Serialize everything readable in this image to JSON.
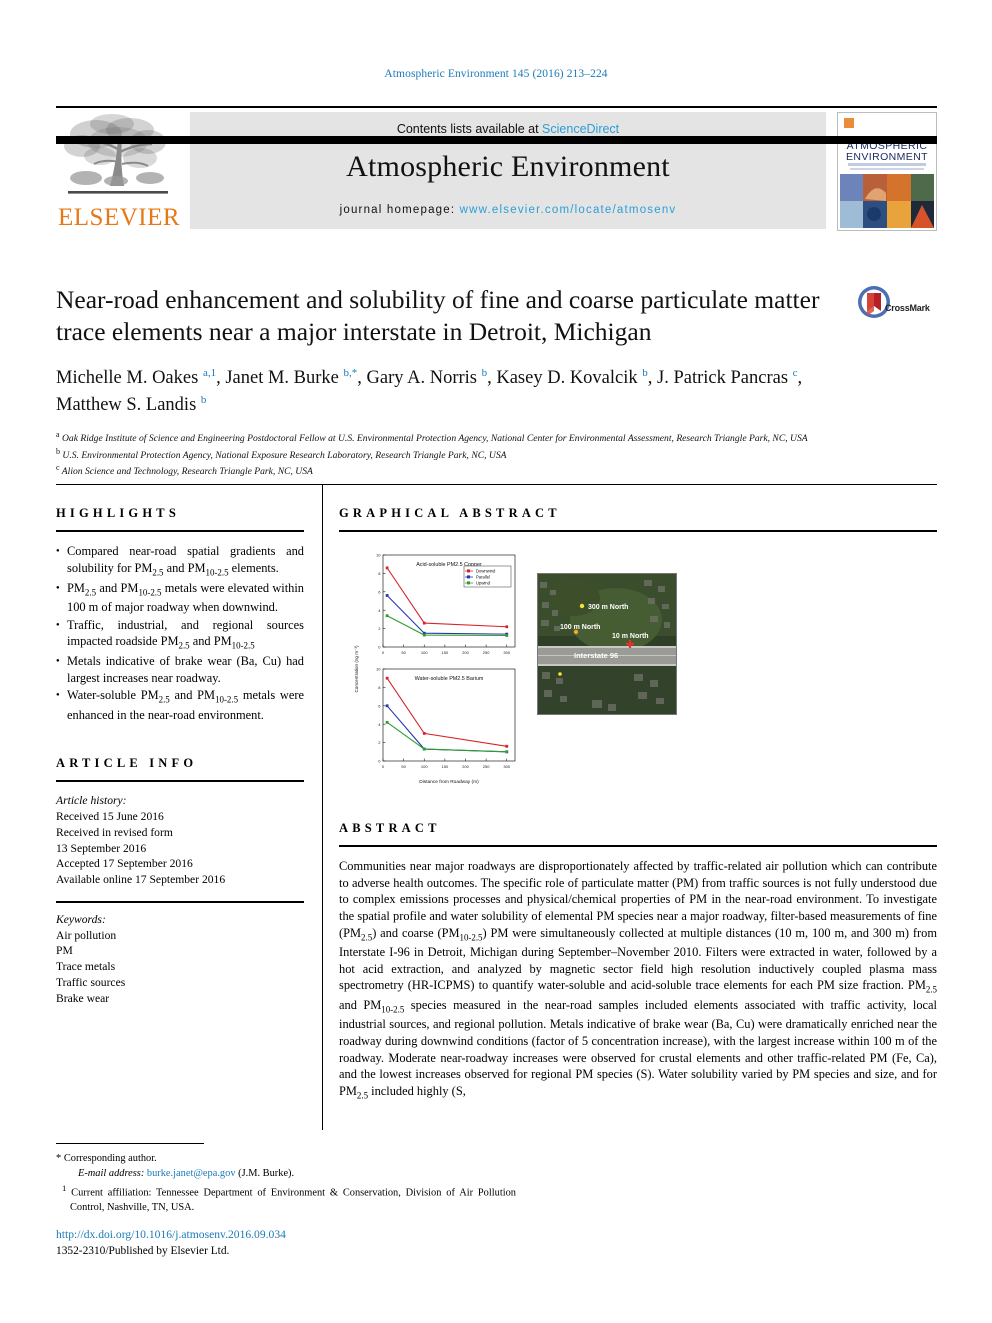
{
  "running_head": "Atmospheric Environment 145 (2016) 213–224",
  "masthead": {
    "contents_prefix": "Contents lists available at ",
    "sciencedirect": "ScienceDirect",
    "journal_title": "Atmospheric Environment",
    "homepage_prefix": "journal homepage: ",
    "homepage_url": "www.elsevier.com/locate/atmosenv",
    "publisher": "ELSEVIER",
    "cover_title_line1": "ATMOSPHERIC",
    "cover_title_line2": "ENVIRONMENT",
    "accent_blue": "#2b9fd6",
    "elsevier_orange": "#e77817"
  },
  "title": "Near-road enhancement and solubility of fine and coarse particulate matter trace elements near a major interstate in Detroit, Michigan",
  "crossmark_label": "CrossMark",
  "authors_html": "Michelle M. Oakes <sup>a,1</sup>, Janet M. Burke <sup>b,</sup><sup class=\"star\">*</sup>, Gary A. Norris <sup>b</sup>, Kasey D. Kovalcik <sup>b</sup>, J. Patrick Pancras <sup>c</sup>, Matthew S. Landis <sup>b</sup>",
  "affiliations": [
    {
      "marker": "a",
      "text": "Oak Ridge Institute of Science and Engineering Postdoctoral Fellow at U.S. Environmental Protection Agency, National Center for Environmental Assessment, Research Triangle Park, NC, USA"
    },
    {
      "marker": "b",
      "text": "U.S. Environmental Protection Agency, National Exposure Research Laboratory, Research Triangle Park, NC, USA"
    },
    {
      "marker": "c",
      "text": "Alion Science and Technology, Research Triangle Park, NC, USA"
    }
  ],
  "sections": {
    "highlights_heading": "HIGHLIGHTS",
    "graphical_abstract_heading": "GRAPHICAL ABSTRACT",
    "article_info_heading": "ARTICLE INFO",
    "abstract_heading": "ABSTRACT"
  },
  "highlights": [
    "Compared near-road spatial gradients and solubility for PM<sub class=\"small\">2.5</sub> and PM<sub class=\"small\">10-2.5</sub> elements.",
    "PM<sub class=\"small\">2.5</sub> and PM<sub class=\"small\">10-2.5</sub> metals were elevated within 100 m of major roadway when downwind.",
    "Traffic, industrial, and regional sources impacted roadside PM<sub class=\"small\">2.5</sub> and PM<sub class=\"small\">10-2.5</sub>",
    "Metals indicative of brake wear (Ba, Cu) had largest increases near roadway.",
    "Water-soluble PM<sub class=\"small\">2.5</sub> and PM<sub class=\"small\">10-2.5</sub> metals were enhanced in the near-road environment."
  ],
  "article_history": {
    "label": "Article history:",
    "lines": [
      "Received 15 June 2016",
      "Received in revised form",
      "13 September 2016",
      "Accepted 17 September 2016",
      "Available online 17 September 2016"
    ]
  },
  "keywords": {
    "label": "Keywords:",
    "items": [
      "Air pollution",
      "PM",
      "Trace metals",
      "Traffic sources",
      "Brake wear"
    ]
  },
  "abstract_html": "Communities near major roadways are disproportionately affected by traffic-related air pollution which can contribute to adverse health outcomes. The specific role of particulate matter (PM) from traffic sources is not fully understood due to complex emissions processes and physical/chemical properties of PM in the near-road environment. To investigate the spatial profile and water solubility of elemental PM species near a major roadway, filter-based measurements of fine (PM<sub class=\"small\">2.5</sub>) and coarse (PM<sub class=\"small\">10-2.5</sub>) PM were simultaneously collected at multiple distances (10 m, 100 m, and 300 m) from Interstate I-96 in Detroit, Michigan during September–November 2010. Filters were extracted in water, followed by a hot acid extraction, and analyzed by magnetic sector field high resolution inductively coupled plasma mass spectrometry (HR-ICPMS) to quantify water-soluble and acid-soluble trace elements for each PM size fraction. PM<sub class=\"small\">2.5</sub> and PM<sub class=\"small\">10-2.5</sub> species measured in the near-road samples included elements associated with traffic activity, local industrial sources, and regional pollution. Metals indicative of brake wear (Ba, Cu) were dramatically enriched near the roadway during downwind conditions (factor of 5 concentration increase), with the largest increase within 100 m of the roadway. Moderate near-roadway increases were observed for crustal elements and other traffic-related PM (Fe, Ca), and the lowest increases observed for regional PM species (S). Water solubility varied by PM species and size, and for PM<sub class=\"small\">2.5</sub> included highly (S,",
  "footnotes": {
    "corresponding_marker": "*",
    "corresponding_text": "Corresponding author.",
    "email_label": "E-mail address:",
    "email": "burke.janet@epa.gov",
    "email_attrib": "(J.M. Burke).",
    "affil_marker": "1",
    "affil_text": "Current affiliation: Tennessee Department of Environment & Conservation, Division of Air Pollution Control, Nashville, TN, USA."
  },
  "footer": {
    "doi": "http://dx.doi.org/10.1016/j.atmosenv.2016.09.034",
    "issn_line": "1352-2310/Published by Elsevier Ltd."
  },
  "chart_data": [
    {
      "type": "line",
      "title": "Acid-soluble PM2.5 Copper",
      "xlabel": "Distance from Roadway (m)",
      "ylabel": "Concentration (ng m⁻³)",
      "x": [
        10,
        100,
        300
      ],
      "xlim": [
        0,
        320
      ],
      "ylim": [
        0,
        10
      ],
      "series": [
        {
          "name": "Downwind",
          "color": "#d8232a",
          "values": [
            8.6,
            2.6,
            2.2
          ]
        },
        {
          "name": "Parallel",
          "color": "#2338b0",
          "values": [
            5.6,
            1.5,
            1.4
          ]
        },
        {
          "name": "Upwind",
          "color": "#2f9e2f",
          "values": [
            3.4,
            1.3,
            1.25
          ]
        }
      ],
      "legend_position": "top-right",
      "grid": false
    },
    {
      "type": "line",
      "title": "Water-soluble PM2.5 Barium",
      "xlabel": "Distance from Roadway (m)",
      "ylabel": "Concentration (ng m⁻³)",
      "x": [
        10,
        100,
        300
      ],
      "xlim": [
        0,
        320
      ],
      "ylim": [
        0,
        10
      ],
      "series": [
        {
          "name": "Downwind",
          "color": "#d8232a",
          "values": [
            9.0,
            3.0,
            1.6
          ]
        },
        {
          "name": "Parallel",
          "color": "#2338b0",
          "values": [
            6.0,
            1.3,
            1.0
          ]
        },
        {
          "name": "Upwind",
          "color": "#2f9e2f",
          "values": [
            4.2,
            1.3,
            1.0
          ]
        }
      ],
      "legend_position": "none",
      "grid": false
    }
  ],
  "map": {
    "labels": [
      {
        "text": "300 m North",
        "color": "#f5e23a"
      },
      {
        "text": "100 m North",
        "color": "#f5a623"
      },
      {
        "text": "10 m North",
        "color": "#e83030"
      },
      {
        "text": "Interstate 96",
        "color": "#ffffff"
      }
    ]
  }
}
